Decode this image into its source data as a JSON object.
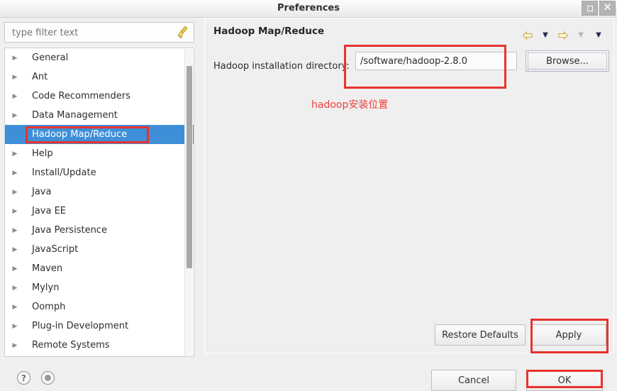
{
  "window": {
    "title": "Preferences",
    "restore_label": "Restore",
    "close_label": "Close"
  },
  "sidebar": {
    "filter": {
      "value": "",
      "placeholder": "type filter text",
      "clear_icon": "broom-icon"
    },
    "items": [
      {
        "label": "General",
        "expandable": true,
        "selected": false
      },
      {
        "label": "Ant",
        "expandable": true,
        "selected": false
      },
      {
        "label": "Code Recommenders",
        "expandable": true,
        "selected": false
      },
      {
        "label": "Data Management",
        "expandable": true,
        "selected": false
      },
      {
        "label": "Hadoop Map/Reduce",
        "expandable": false,
        "selected": true
      },
      {
        "label": "Help",
        "expandable": true,
        "selected": false
      },
      {
        "label": "Install/Update",
        "expandable": true,
        "selected": false
      },
      {
        "label": "Java",
        "expandable": true,
        "selected": false
      },
      {
        "label": "Java EE",
        "expandable": true,
        "selected": false
      },
      {
        "label": "Java Persistence",
        "expandable": true,
        "selected": false
      },
      {
        "label": "JavaScript",
        "expandable": true,
        "selected": false
      },
      {
        "label": "Maven",
        "expandable": true,
        "selected": false
      },
      {
        "label": "Mylyn",
        "expandable": true,
        "selected": false
      },
      {
        "label": "Oomph",
        "expandable": true,
        "selected": false
      },
      {
        "label": "Plug-in Development",
        "expandable": true,
        "selected": false
      },
      {
        "label": "Remote Systems",
        "expandable": true,
        "selected": false
      }
    ]
  },
  "content": {
    "page_title": "Hadoop Map/Reduce",
    "nav": {
      "back_icon": "back-arrow-icon",
      "back_menu_icon": "chevron-down-icon",
      "forward_icon": "forward-arrow-icon",
      "forward_menu_icon": "chevron-down-icon",
      "menu_icon": "chevron-down-icon"
    },
    "field": {
      "label": "Hadoop installation directory:",
      "value": "/software/hadoop-2.8.0",
      "browse_label": "Browse..."
    },
    "annotation": "hadoop安装位置",
    "restore_defaults_label": "Restore Defaults",
    "apply_label": "Apply"
  },
  "footer": {
    "help_icon": "question-mark-icon",
    "mode_icon": "filled-circle-icon",
    "cancel_label": "Cancel",
    "ok_label": "OK"
  },
  "colors": {
    "selection_blue": "#3f8fd8",
    "annotation_red": "#e8332e",
    "annotation_text_red": "#f0403a",
    "window_bg": "#efefef"
  }
}
